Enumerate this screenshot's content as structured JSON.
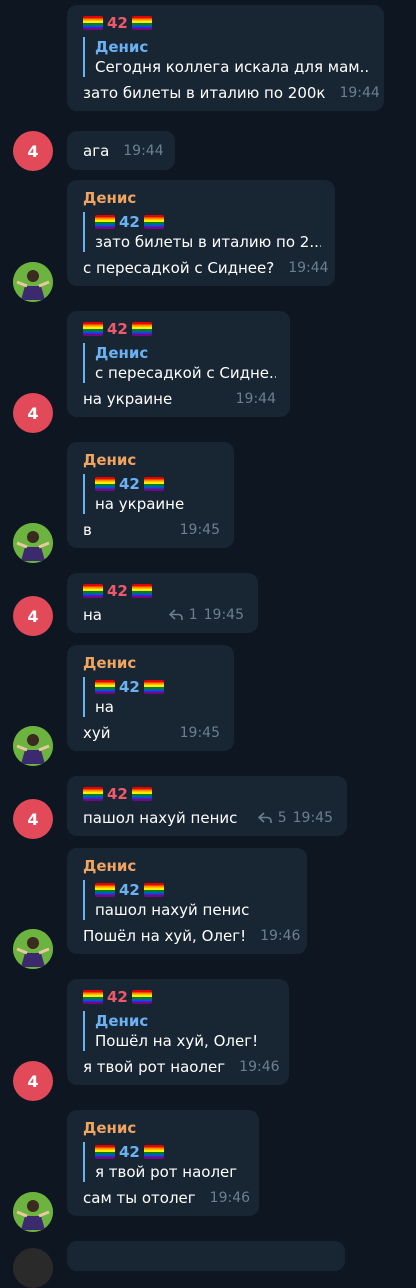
{
  "flag_label": "42",
  "avatar_letter": "4",
  "messages": [
    {
      "sender": "42",
      "sender_flagged": true,
      "reply_name": "Денис",
      "reply_text": "Сегодня коллега искала для мам...",
      "text": "зато билеты в италию по 200к",
      "time": "19:44",
      "avatar": "none"
    },
    {
      "sender": "",
      "text": "ага",
      "time": "19:44",
      "avatar": "red"
    },
    {
      "sender": "Денис",
      "reply_name": "42",
      "reply_flagged": true,
      "reply_text": "зато билеты в италию по 2...",
      "text": "с пересадкой с Сиднее?",
      "time": "19:44",
      "avatar": "photo"
    },
    {
      "sender": "42",
      "sender_flagged": true,
      "reply_name": "Денис",
      "reply_text": "с пересадкой с Сидне...",
      "text": "на украине",
      "time": "19:44",
      "avatar": "red"
    },
    {
      "sender": "Денис",
      "reply_name": "42",
      "reply_flagged": true,
      "reply_text": "на украине",
      "text": "в",
      "time": "19:45",
      "avatar": "photo"
    },
    {
      "sender": "42",
      "sender_flagged": true,
      "text": "на",
      "replies": "1",
      "time": "19:45",
      "avatar": "red"
    },
    {
      "sender": "Денис",
      "reply_name": "42",
      "reply_flagged": true,
      "reply_text": "на",
      "text": "хуй",
      "time": "19:45",
      "avatar": "photo"
    },
    {
      "sender": "42",
      "sender_flagged": true,
      "text": "пашол нахуй пенис",
      "replies": "5",
      "time": "19:45",
      "avatar": "red"
    },
    {
      "sender": "Денис",
      "reply_name": "42",
      "reply_flagged": true,
      "reply_text": "пашол нахуй пенис",
      "text": "Пошёл на хуй, Олег!",
      "time": "19:46",
      "avatar": "photo"
    },
    {
      "sender": "42",
      "sender_flagged": true,
      "reply_name": "Денис",
      "reply_text": "Пошёл на хуй, Олег!",
      "text": "я твой рот наолег",
      "time": "19:46",
      "avatar": "red"
    },
    {
      "sender": "Денис",
      "reply_name": "42",
      "reply_flagged": true,
      "reply_text": "я твой рот наолег",
      "text": "сам ты отолег",
      "time": "19:46",
      "avatar": "photo"
    }
  ]
}
